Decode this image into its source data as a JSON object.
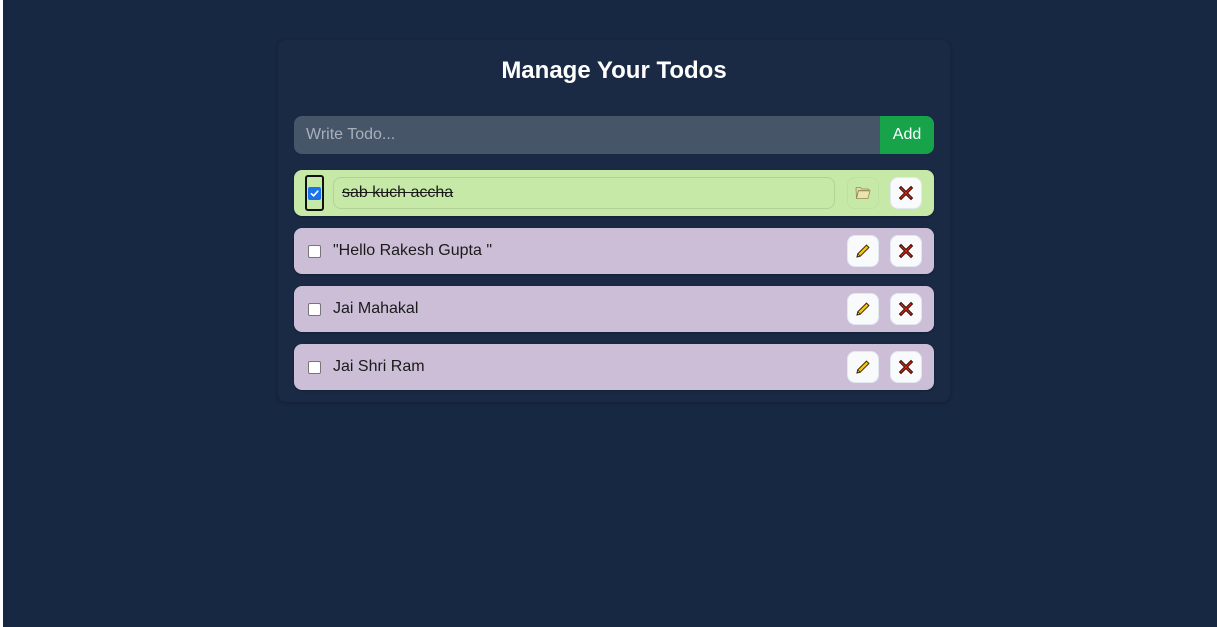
{
  "header": {
    "title": "Manage Your Todos"
  },
  "form": {
    "placeholder": "Write Todo...",
    "value": "",
    "add_label": "Add"
  },
  "colors": {
    "background": "#172842",
    "completed_row": "#c6e9a7",
    "pending_row": "#ccbed7",
    "add_button": "#16a34a",
    "input_bg": "#475569"
  },
  "todos": [
    {
      "text": "sab kuch accha",
      "completed": true,
      "edit_icon": "folder-icon",
      "delete_icon": "close-x-icon"
    },
    {
      "text": "\"Hello Rakesh Gupta \"",
      "completed": false,
      "edit_icon": "pencil-icon",
      "delete_icon": "close-x-icon"
    },
    {
      "text": "Jai Mahakal",
      "completed": false,
      "edit_icon": "pencil-icon",
      "delete_icon": "close-x-icon"
    },
    {
      "text": "Jai Shri Ram",
      "completed": false,
      "edit_icon": "pencil-icon",
      "delete_icon": "close-x-icon"
    }
  ]
}
